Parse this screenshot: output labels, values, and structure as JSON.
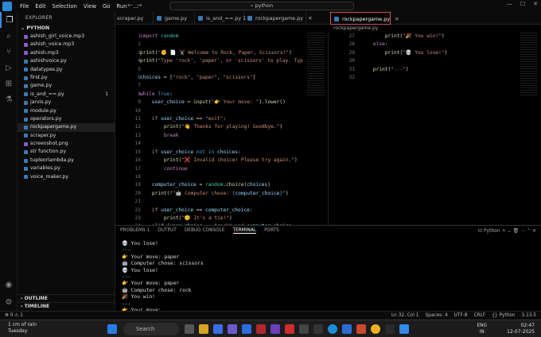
{
  "titlebar": {
    "menu": [
      "File",
      "Edit",
      "Selection",
      "View",
      "Go",
      "Run",
      "…"
    ],
    "search": "python"
  },
  "sidebar": {
    "header": "EXPLORER",
    "folder": "PYTHON",
    "files": [
      {
        "name": "ashish_girl_voice.mp3",
        "color": "#8a5cc7"
      },
      {
        "name": "ashish_voice.mp3",
        "color": "#8a5cc7"
      },
      {
        "name": "ashish.mp3",
        "color": "#8a5cc7"
      },
      {
        "name": "ashishvoice.py",
        "color": "#3b78b5"
      },
      {
        "name": "datatypes.py",
        "color": "#3b78b5"
      },
      {
        "name": "first.py",
        "color": "#3b78b5"
      },
      {
        "name": "game.py",
        "color": "#3b78b5"
      },
      {
        "name": "is_and_==.py",
        "color": "#3b78b5",
        "badge": "1"
      },
      {
        "name": "jarvis.py",
        "color": "#3b78b5"
      },
      {
        "name": "module.py",
        "color": "#3b78b5"
      },
      {
        "name": "operators.py",
        "color": "#3b78b5"
      },
      {
        "name": "rockpapergame.py",
        "color": "#3b78b5",
        "selected": true
      },
      {
        "name": "scraper.py",
        "color": "#3b78b5"
      },
      {
        "name": "screenshot.png",
        "color": "#8a5cc7"
      },
      {
        "name": "str function.py",
        "color": "#3b78b5"
      },
      {
        "name": "tupleorlambda.py",
        "color": "#3b78b5"
      },
      {
        "name": "variables.py",
        "color": "#3b78b5"
      },
      {
        "name": "voice_maker.py",
        "color": "#3b78b5"
      }
    ],
    "outline": "OUTLINE",
    "timeline": "TIMELINE"
  },
  "tabs": [
    "scraper.py",
    "game.py",
    "is_and_==.py 1",
    "rockpapergame.py",
    "rockpapergame.py"
  ],
  "breadcrumb": "rockpapergame.py",
  "editor_left": {
    "line_numbers": [
      "1",
      "2",
      "3",
      "4",
      "5",
      "6",
      "7",
      "8",
      "9",
      "10",
      "11",
      "12",
      "13",
      "14",
      "15",
      "16",
      "17",
      "18",
      "19",
      "20",
      "21",
      "22",
      "23",
      "24",
      "25",
      "26",
      "27"
    ]
  },
  "editor_right": {
    "line_numbers": [
      "27",
      "28",
      "29",
      "30",
      "31",
      "32"
    ]
  },
  "panel": {
    "tabs": [
      "PROBLEMS 1",
      "OUTPUT",
      "DEBUG CONSOLE",
      "TERMINAL",
      "PORTS"
    ],
    "active_tab": "TERMINAL",
    "shell": "Python",
    "terminal_lines": [
      "💀 You lose!",
      "---",
      "👉 Your move: paper",
      "🤖 Computer chose: scissors",
      "💀 You lose!",
      "---",
      "👉 Your move: paper",
      "🤖 Computer chose: rock",
      "🎉 You win!",
      "---",
      "👉 Your move: "
    ]
  },
  "statusbar": {
    "left": "⊗ 0 ⚠ 1",
    "items": [
      "Ln 32, Col 1",
      "Spaces: 4",
      "UTF-8",
      "CRLF",
      "{} Python",
      "3.13.5"
    ]
  },
  "taskbar": {
    "weather_temp": "1 cm of rain",
    "weather_day": "Tuesday",
    "search": "Search",
    "lang1": "ENG",
    "lang2": "IN",
    "time": "02:47",
    "date": "12-07-2025"
  }
}
